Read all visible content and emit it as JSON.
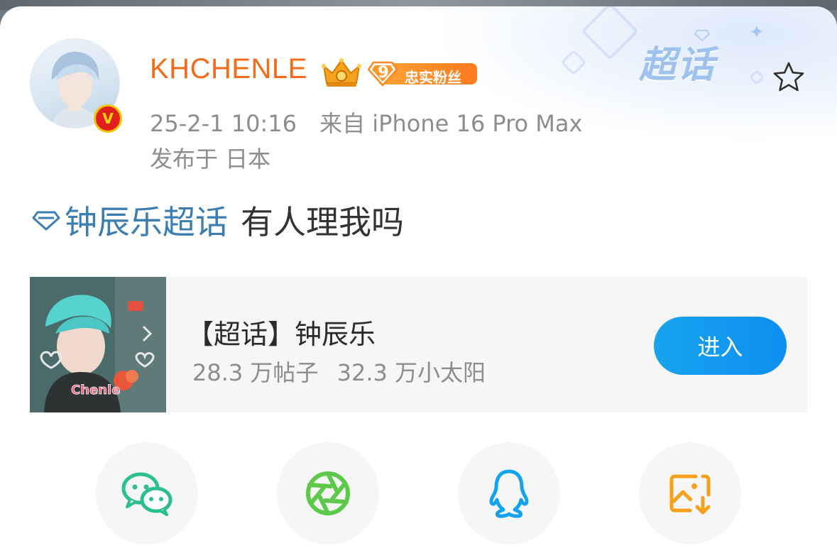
{
  "post": {
    "username": "KHCHENLE",
    "fan_badge": {
      "level": "9",
      "label": "忠实粉丝"
    },
    "verified_mark": "V",
    "timestamp": "25-2-1 10:16",
    "source": "来自 iPhone 16 Pro Max",
    "location": "发布于 日本",
    "topic": "钟辰乐超话",
    "text": "有人理我吗",
    "decoration_logo": "超话"
  },
  "topic_card": {
    "title": "【超话】钟辰乐",
    "posts": "28.3 万帖子",
    "suns": "32.3 万小太阳",
    "enter_label": "进入",
    "thumb_caption": "Chenle"
  },
  "share": {
    "icons": [
      "wechat-icon",
      "moments-icon",
      "qq-icon",
      "save-image-icon"
    ]
  },
  "colors": {
    "username": "#f36c1c",
    "topic_link": "#3d7eb0",
    "enter_button": "#0d8ff0",
    "wechat": "#2bc08a",
    "moments": "#5cc94a",
    "qq": "#13a3ec",
    "save": "#f5a11c"
  }
}
